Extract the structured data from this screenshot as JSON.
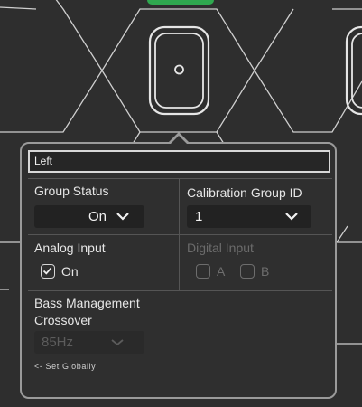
{
  "speaker": {
    "name": "Left"
  },
  "group_status": {
    "label": "Group Status",
    "value": "On"
  },
  "calibration_group": {
    "label": "Calibration Group ID",
    "value": "1"
  },
  "analog_input": {
    "label": "Analog Input",
    "option_label": "On",
    "checked": true
  },
  "digital_input": {
    "label": "Digital Input",
    "option_a": "A",
    "option_b": "B",
    "enabled": false
  },
  "bass_management": {
    "label_line1": "Bass Management",
    "label_line2": "Crossover",
    "value": "85Hz",
    "enabled": false,
    "set_globally": "<- Set Globally"
  },
  "colors": {
    "background": "#2e2e2e",
    "hex_lines": "#cfcfcf",
    "accent_green": "#2fa84f",
    "panel_border": "#9a9a9a"
  }
}
